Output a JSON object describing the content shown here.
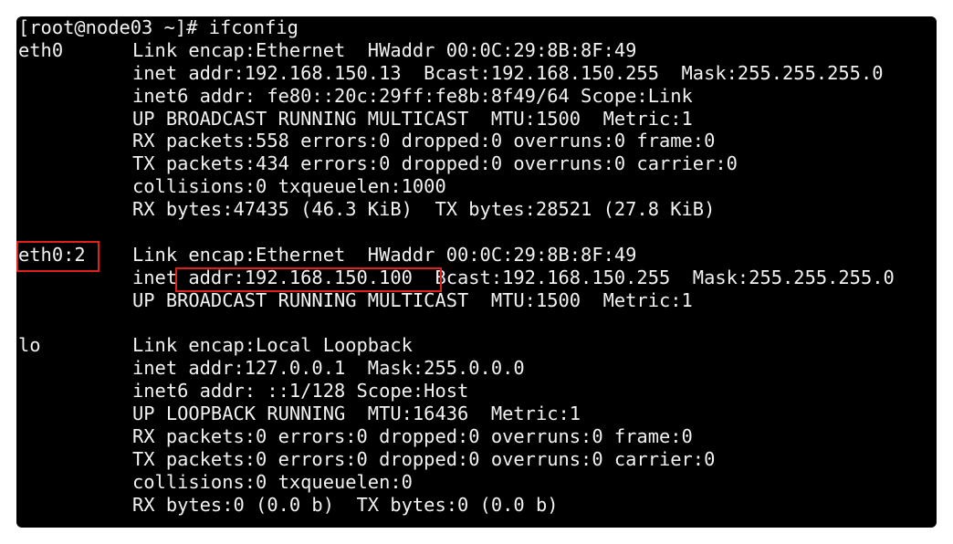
{
  "terminal": {
    "prompt_line": "[root@node03 ~]# ifconfig",
    "interfaces": [
      {
        "name": "eth0",
        "lines": [
          "Link encap:Ethernet  HWaddr 00:0C:29:8B:8F:49",
          "inet addr:192.168.150.13  Bcast:192.168.150.255  Mask:255.255.255.0",
          "inet6 addr: fe80::20c:29ff:fe8b:8f49/64 Scope:Link",
          "UP BROADCAST RUNNING MULTICAST  MTU:1500  Metric:1",
          "RX packets:558 errors:0 dropped:0 overruns:0 frame:0",
          "TX packets:434 errors:0 dropped:0 overruns:0 carrier:0",
          "collisions:0 txqueuelen:1000",
          "RX bytes:47435 (46.3 KiB)  TX bytes:28521 (27.8 KiB)"
        ]
      },
      {
        "name": "eth0:2",
        "lines": [
          "Link encap:Ethernet  HWaddr 00:0C:29:8B:8F:49",
          "inet addr:192.168.150.100  Bcast:192.168.150.255  Mask:255.255.255.0",
          "UP BROADCAST RUNNING MULTICAST  MTU:1500  Metric:1"
        ]
      },
      {
        "name": "lo",
        "lines": [
          "Link encap:Local Loopback",
          "inet addr:127.0.0.1  Mask:255.0.0.0",
          "inet6 addr: ::1/128 Scope:Host",
          "UP LOOPBACK RUNNING  MTU:16436  Metric:1",
          "RX packets:0 errors:0 dropped:0 overruns:0 frame:0",
          "TX packets:0 errors:0 dropped:0 overruns:0 carrier:0",
          "collisions:0 txqueuelen:0",
          "RX bytes:0 (0.0 b)  TX bytes:0 (0.0 b)"
        ]
      }
    ]
  },
  "annotation_color": "#e0201c",
  "terminal_bg": "#000000",
  "terminal_fg": "#f2f2f2"
}
